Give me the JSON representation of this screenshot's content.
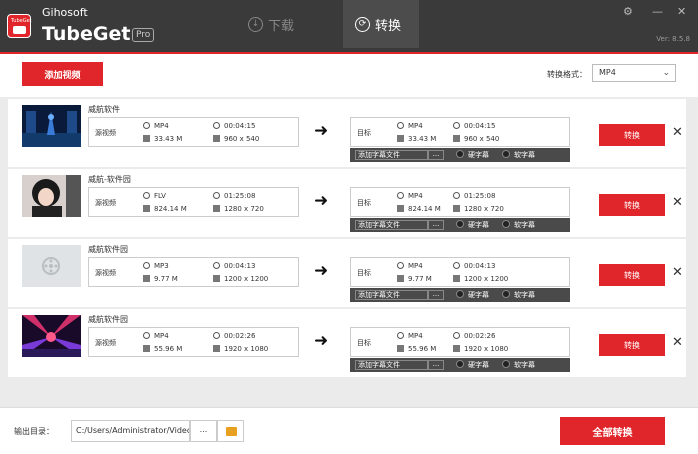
{
  "app": {
    "company": "Gihosoft",
    "name": "TubeGet",
    "badge": "Pro",
    "logo_text": "TubeGet",
    "version": "Ver: 8.5.8"
  },
  "tabs": [
    {
      "label": "下载"
    },
    {
      "label": "转换"
    }
  ],
  "toolbar": {
    "add_label": "添加视频",
    "format_label": "转换格式：",
    "format_value": "MP4"
  },
  "labels": {
    "source": "源视频",
    "target": "目标",
    "convert": "转换",
    "add_subtitle": "添加字幕文件",
    "dots": "...",
    "hard_sub": "硬字幕",
    "soft_sub": "软字幕"
  },
  "rows": [
    {
      "title": "威航软件",
      "src": {
        "format": "MP4",
        "duration": "00:04:15",
        "size": "33.43 M",
        "resolution": "960 x 540"
      },
      "dst": {
        "format": "MP4",
        "duration": "00:04:15",
        "size": "33.43 M",
        "resolution": "960 x 540"
      }
    },
    {
      "title": "威航-软件园",
      "src": {
        "format": "FLV",
        "duration": "01:25:08",
        "size": "824.14 M",
        "resolution": "1280 x 720"
      },
      "dst": {
        "format": "MP4",
        "duration": "01:25:08",
        "size": "824.14 M",
        "resolution": "1280 x 720"
      }
    },
    {
      "title": "威航软件园",
      "src": {
        "format": "MP3",
        "duration": "00:04:13",
        "size": "9.77 M",
        "resolution": "1200 x 1200"
      },
      "dst": {
        "format": "MP4",
        "duration": "00:04:13",
        "size": "9.77 M",
        "resolution": "1200 x 1200"
      }
    },
    {
      "title": "威航软件园",
      "src": {
        "format": "MP4",
        "duration": "00:02:26",
        "size": "55.96 M",
        "resolution": "1920 x 1080"
      },
      "dst": {
        "format": "MP4",
        "duration": "00:02:26",
        "size": "55.96 M",
        "resolution": "1920 x 1080"
      }
    }
  ],
  "bottom": {
    "output_label": "输出目录：",
    "output_path": "C:/Users/Administrator/Videos",
    "dots": "...",
    "convert_all": "全部转换"
  }
}
